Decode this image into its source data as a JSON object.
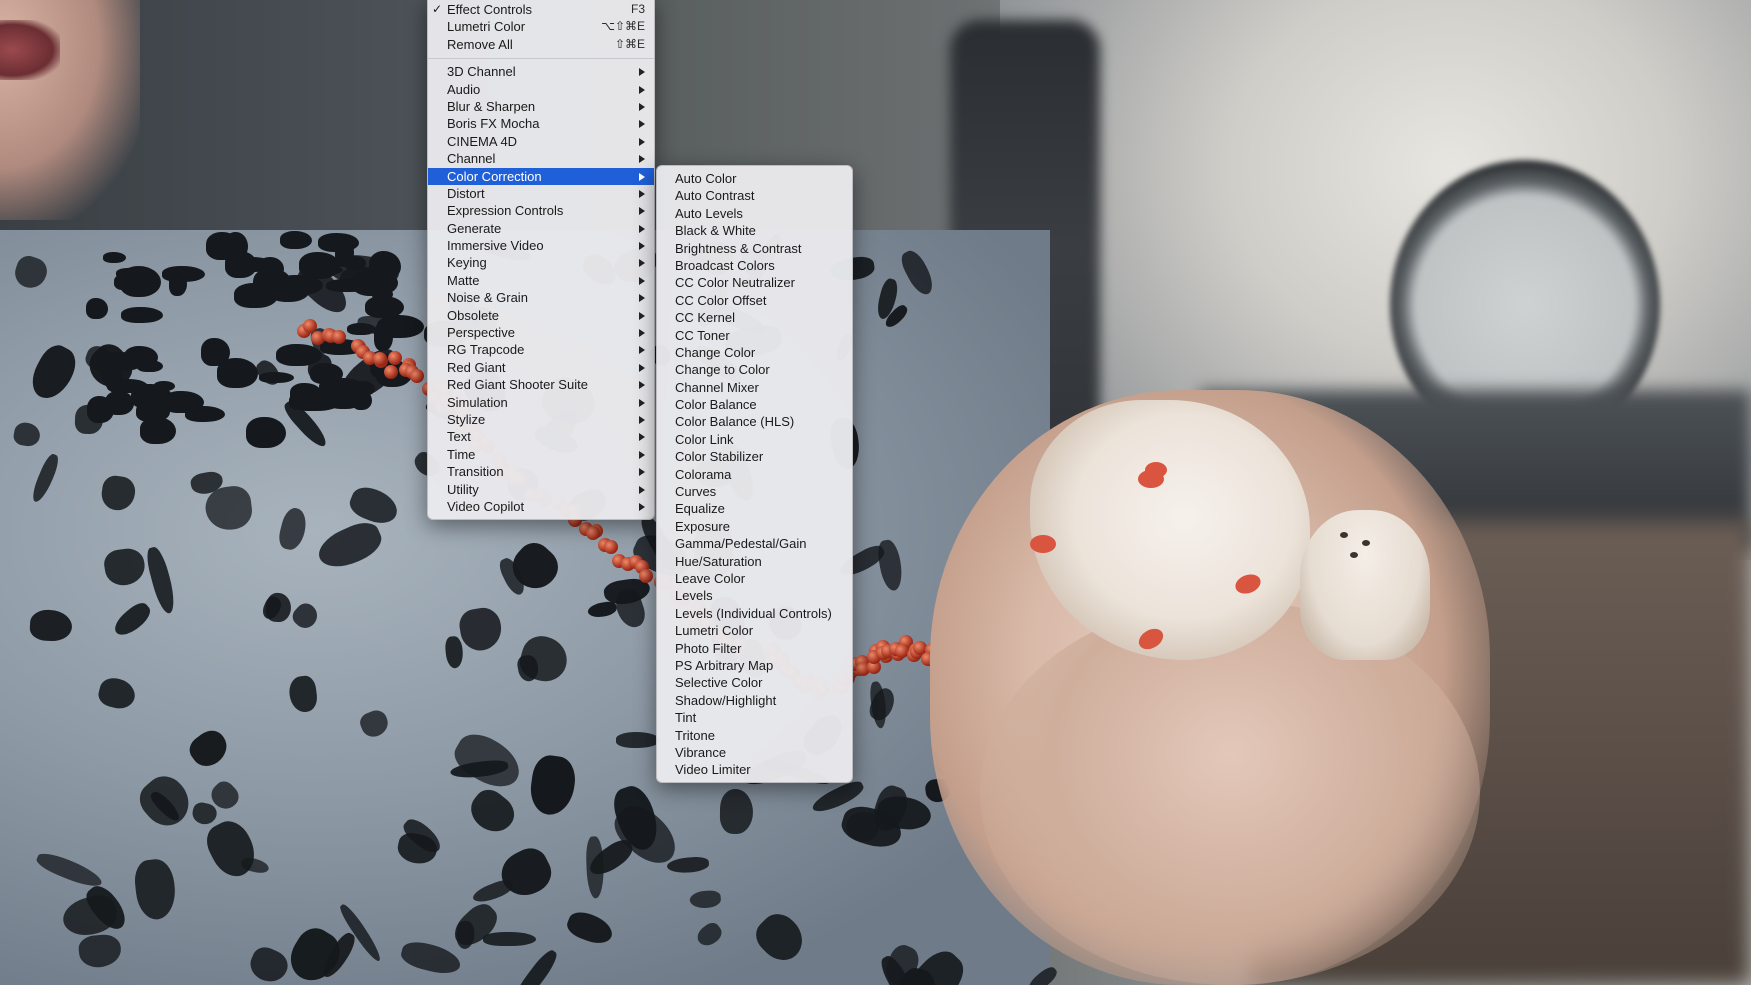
{
  "main_menu": {
    "top_items": [
      {
        "label": "Effect Controls",
        "shortcut": "F3",
        "checked": "✓"
      },
      {
        "label": "Lumetri Color",
        "shortcut": "⌥⇧⌘E",
        "checked": ""
      },
      {
        "label": "Remove All",
        "shortcut": "⇧⌘E",
        "checked": ""
      }
    ],
    "categories": [
      "3D Channel",
      "Audio",
      "Blur & Sharpen",
      "Boris FX Mocha",
      "CINEMA 4D",
      "Channel",
      "Color Correction",
      "Distort",
      "Expression Controls",
      "Generate",
      "Immersive Video",
      "Keying",
      "Matte",
      "Noise & Grain",
      "Obsolete",
      "Perspective",
      "RG Trapcode",
      "Red Giant",
      "Red Giant Shooter Suite",
      "Simulation",
      "Stylize",
      "Text",
      "Time",
      "Transition",
      "Utility",
      "Video Copilot"
    ],
    "selected": "Color Correction"
  },
  "sub_menu": {
    "items": [
      "Auto Color",
      "Auto Contrast",
      "Auto Levels",
      "Black & White",
      "Brightness & Contrast",
      "Broadcast Colors",
      "CC Color Neutralizer",
      "CC Color Offset",
      "CC Kernel",
      "CC Toner",
      "Change Color",
      "Change to Color",
      "Channel Mixer",
      "Color Balance",
      "Color Balance (HLS)",
      "Color Link",
      "Color Stabilizer",
      "Colorama",
      "Curves",
      "Equalize",
      "Exposure",
      "Gamma/Pedestal/Gain",
      "Hue/Saturation",
      "Leave Color",
      "Levels",
      "Levels (Individual Controls)",
      "Lumetri Color",
      "Photo Filter",
      "PS Arbitrary Map",
      "Selective Color",
      "Shadow/Highlight",
      "Tint",
      "Tritone",
      "Vibrance",
      "Video Limiter"
    ]
  },
  "colors": {
    "selection": "#1f5fd8",
    "menu_bg": "#e9e9ec"
  },
  "icons": {
    "check": "checkmark-icon",
    "submenu": "submenu-arrow-icon",
    "cursor": "mouse-cursor-icon"
  }
}
